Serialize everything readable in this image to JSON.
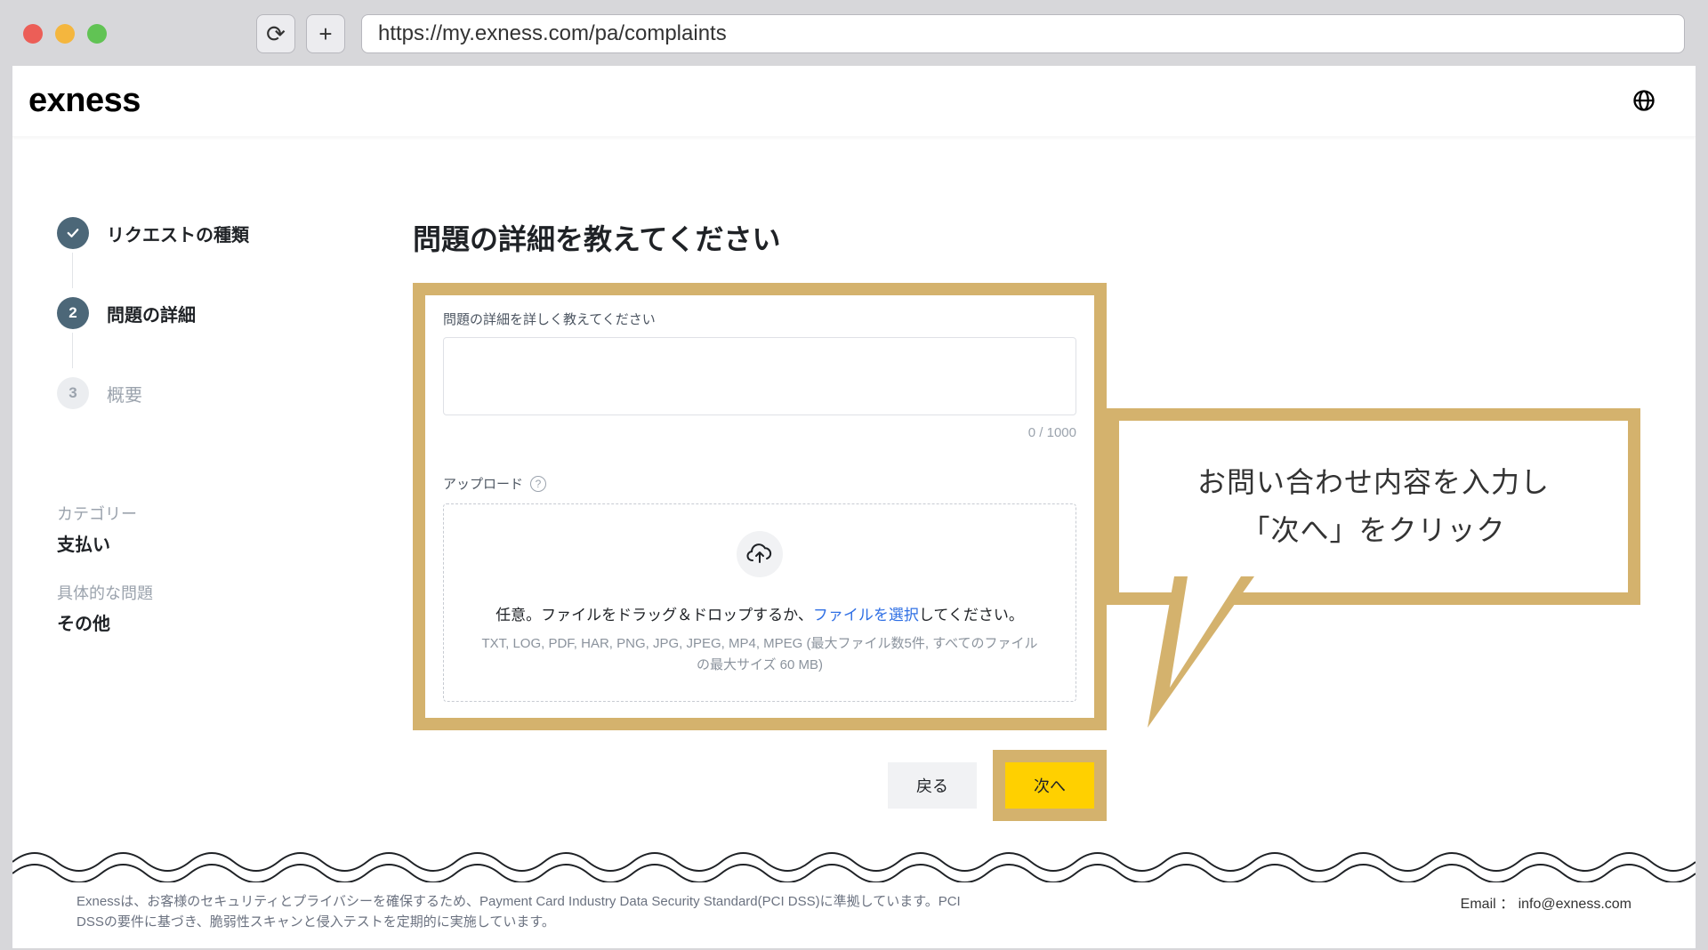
{
  "browser": {
    "url": "https://my.exness.com/pa/complaints"
  },
  "header": {
    "logo_text": "exness"
  },
  "sidebar": {
    "steps": [
      {
        "label": "リクエストの種類",
        "state": "done"
      },
      {
        "number": "2",
        "label": "問題の詳細",
        "state": "current"
      },
      {
        "number": "3",
        "label": "概要",
        "state": "future"
      }
    ],
    "meta": {
      "category_label": "カテゴリー",
      "category_value": "支払い",
      "issue_label": "具体的な問題",
      "issue_value": "その他"
    }
  },
  "content": {
    "title": "問題の詳細を教えてください",
    "detail_label": "問題の詳細を詳しく教えてください",
    "char_count": "0 / 1000",
    "upload_label": "アップロード",
    "drop_text_prefix": "任意。ファイルをドラッグ＆ドロップするか、",
    "drop_text_link": "ファイルを選択",
    "drop_text_suffix": "してください。",
    "drop_hint": "TXT, LOG, PDF, HAR, PNG, JPG, JPEG, MP4, MPEG (最大ファイル数5件, すべてのファイルの最大サイズ 60 MB)",
    "back_label": "戻る",
    "next_label": "次へ"
  },
  "callout": {
    "line1": "お問い合わせ内容を入力し",
    "line2": "「次へ」をクリック"
  },
  "footer": {
    "compliance": "Exnessは、お客様のセキュリティとプライバシーを確保するため、Payment Card Industry Data Security Standard(PCI DSS)に準拠しています。PCI DSSの要件に基づき、脆弱性スキャンと侵入テストを定期的に実施しています。",
    "email_label": "Email ：",
    "email_value": "info@exness.com"
  }
}
